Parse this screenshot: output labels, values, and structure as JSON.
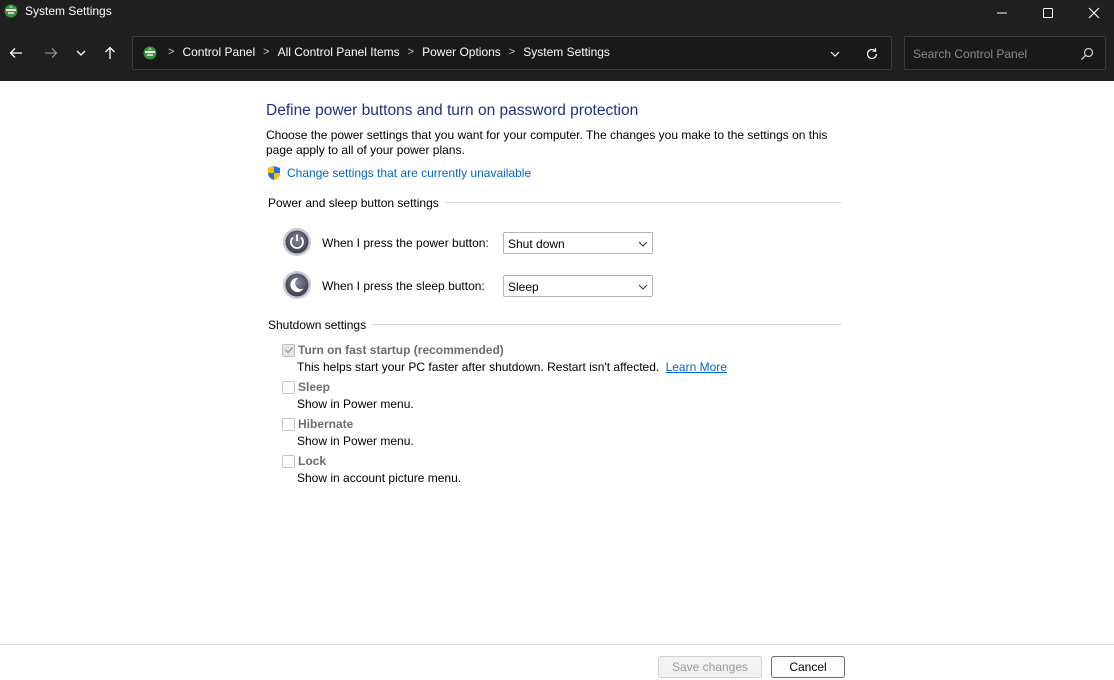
{
  "window": {
    "title": "System Settings"
  },
  "address": {
    "breadcrumbs": [
      "Control Panel",
      "All Control Panel Items",
      "Power Options",
      "System Settings"
    ]
  },
  "search": {
    "placeholder": "Search Control Panel"
  },
  "main": {
    "title": "Define power buttons and turn on password protection",
    "description": "Choose the power settings that you want for your computer. The changes you make to the settings on this page apply to all of your power plans.",
    "change_link": "Change settings that are currently unavailable"
  },
  "power_sleep": {
    "group_title": "Power and sleep button settings",
    "power_button_label": "When I press the power button:",
    "power_button_value": "Shut down",
    "sleep_button_label": "When I press the sleep button:",
    "sleep_button_value": "Sleep"
  },
  "shutdown": {
    "group_title": "Shutdown settings",
    "fast_startup": {
      "label": "Turn on fast startup (recommended)",
      "checked": true,
      "desc": "This helps start your PC faster after shutdown. Restart isn't affected.",
      "link": "Learn More"
    },
    "sleep": {
      "label": "Sleep",
      "checked": false,
      "desc": "Show in Power menu."
    },
    "hibernate": {
      "label": "Hibernate",
      "checked": false,
      "desc": "Show in Power menu."
    },
    "lock": {
      "label": "Lock",
      "checked": false,
      "desc": "Show in account picture menu."
    }
  },
  "footer": {
    "save_label": "Save changes",
    "cancel_label": "Cancel"
  },
  "colors": {
    "titlebar_bg": "#1f1f1f",
    "heading": "#1e3287",
    "link": "#0066cc"
  }
}
